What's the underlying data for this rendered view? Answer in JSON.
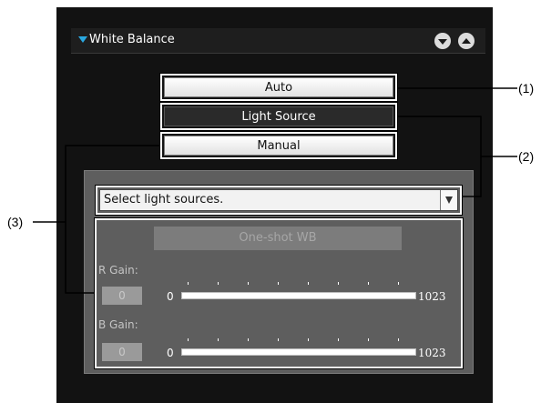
{
  "panel": {
    "title": "White Balance",
    "header_buttons": [
      "collapse-down",
      "expand-up"
    ],
    "accent_color": "#2aa8e0"
  },
  "modes": [
    {
      "label": "Auto",
      "selected": false
    },
    {
      "label": "Light Source",
      "selected": true
    },
    {
      "label": "Manual",
      "selected": false
    }
  ],
  "dropdown": {
    "value": "Select light sources."
  },
  "oneshot": {
    "label": "One-shot WB",
    "enabled": false
  },
  "r_gain": {
    "label": "R Gain:",
    "value": "0",
    "min": "0",
    "max": "1023"
  },
  "b_gain": {
    "label": "B Gain:",
    "value": "0",
    "min": "0",
    "max": "1023"
  },
  "callouts": {
    "c1": "(1)",
    "c2": "(2)",
    "c3": "(3)"
  }
}
